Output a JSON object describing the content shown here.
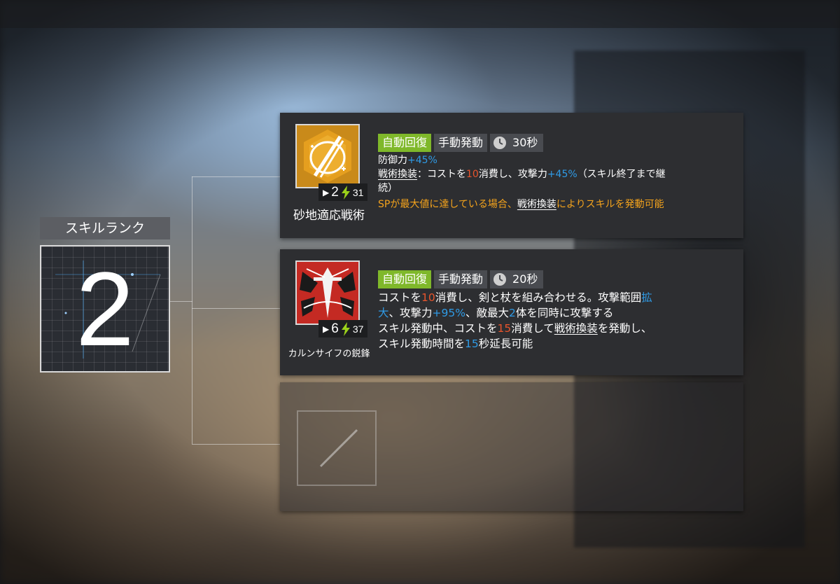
{
  "rank": {
    "title": "スキルランク",
    "value": "2"
  },
  "skills": [
    {
      "name": "砂地適応戦術",
      "level": "2",
      "sp_cost": "31",
      "tags": {
        "recovery": "自動回復",
        "activation": "手動発動",
        "duration": "30秒"
      },
      "desc": {
        "l1_a": "防御力",
        "l1_b": "+45%",
        "l2_a": "戦術換装",
        "l2_b": "：コストを",
        "l2_c": "10",
        "l2_d": "消費し、攻撃力",
        "l2_e": "+45%",
        "l2_f": "（スキル終了まで継",
        "l3": "続）",
        "l4_a": "SPが最大値に達している場合、",
        "l4_b": "戦術換装",
        "l4_c": "によりスキルを発動可能"
      }
    },
    {
      "name": "カルンサイフの鋭鋒",
      "level": "6",
      "sp_cost": "37",
      "tags": {
        "recovery": "自動回復",
        "activation": "手動発動",
        "duration": "20秒"
      },
      "desc": {
        "l1_a": "コストを",
        "l1_b": "10",
        "l1_c": "消費し、剣と杖を組み合わせる。攻撃範囲",
        "l1_d": "拡",
        "l2_a": "大",
        "l2_b": "、攻撃力",
        "l2_c": "+95%",
        "l2_d": "、敵最大",
        "l2_e": "2",
        "l2_f": "体を同時に攻撃する",
        "l3_a": "スキル発動中、コストを",
        "l3_b": "15",
        "l3_c": "消費して",
        "l3_d": "戦術換装",
        "l3_e": "を発動し、",
        "l4_a": "スキル発動時間を",
        "l4_b": "15",
        "l4_c": "秒延長可能"
      }
    }
  ],
  "colors": {
    "tag_green": "#7fb82a",
    "highlight_blue": "#2f9be6",
    "highlight_red": "#e8542c",
    "highlight_orange": "#f4a31c"
  }
}
